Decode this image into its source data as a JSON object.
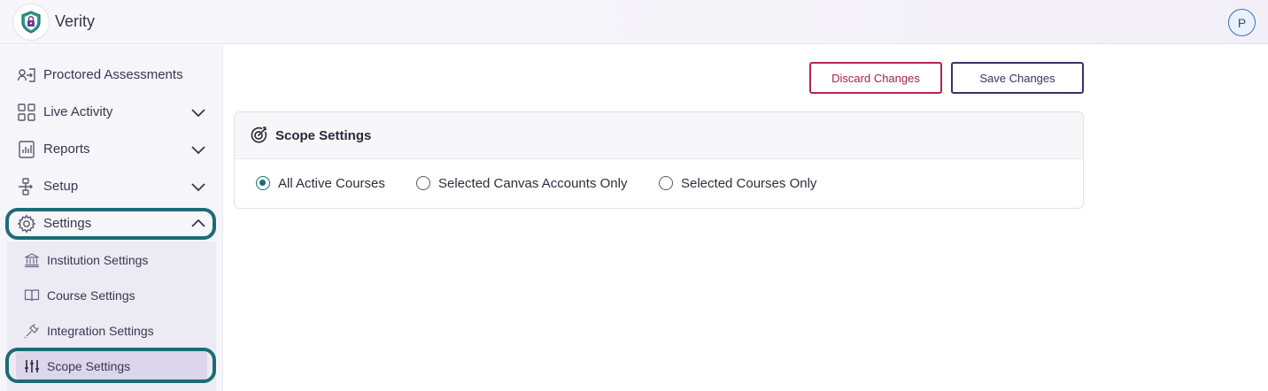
{
  "app": {
    "title": "Verity",
    "avatar_initial": "P"
  },
  "sidebar": {
    "items": [
      {
        "label": "Proctored Assessments",
        "icon": "proctor-icon"
      },
      {
        "label": "Live Activity",
        "icon": "grid-icon"
      },
      {
        "label": "Reports",
        "icon": "report-icon"
      },
      {
        "label": "Setup",
        "icon": "setup-icon"
      },
      {
        "label": "Settings",
        "icon": "gear-icon"
      }
    ],
    "settings_submenu": [
      {
        "label": "Institution Settings",
        "icon": "institution-icon"
      },
      {
        "label": "Course Settings",
        "icon": "book-icon"
      },
      {
        "label": "Integration Settings",
        "icon": "plug-icon"
      },
      {
        "label": "Scope Settings",
        "icon": "sliders-icon",
        "active": true
      }
    ]
  },
  "toolbar": {
    "discard_label": "Discard Changes",
    "save_label": "Save Changes"
  },
  "card": {
    "title": "Scope Settings",
    "options": [
      {
        "label": "All Active Courses",
        "checked": true
      },
      {
        "label": "Selected Canvas Accounts Only",
        "checked": false
      },
      {
        "label": "Selected Courses Only",
        "checked": false
      }
    ]
  },
  "colors": {
    "accent": "#1c6b78",
    "discard": "#b4264f",
    "save": "#3b2f6b",
    "active_bg": "#dcd6ea"
  }
}
